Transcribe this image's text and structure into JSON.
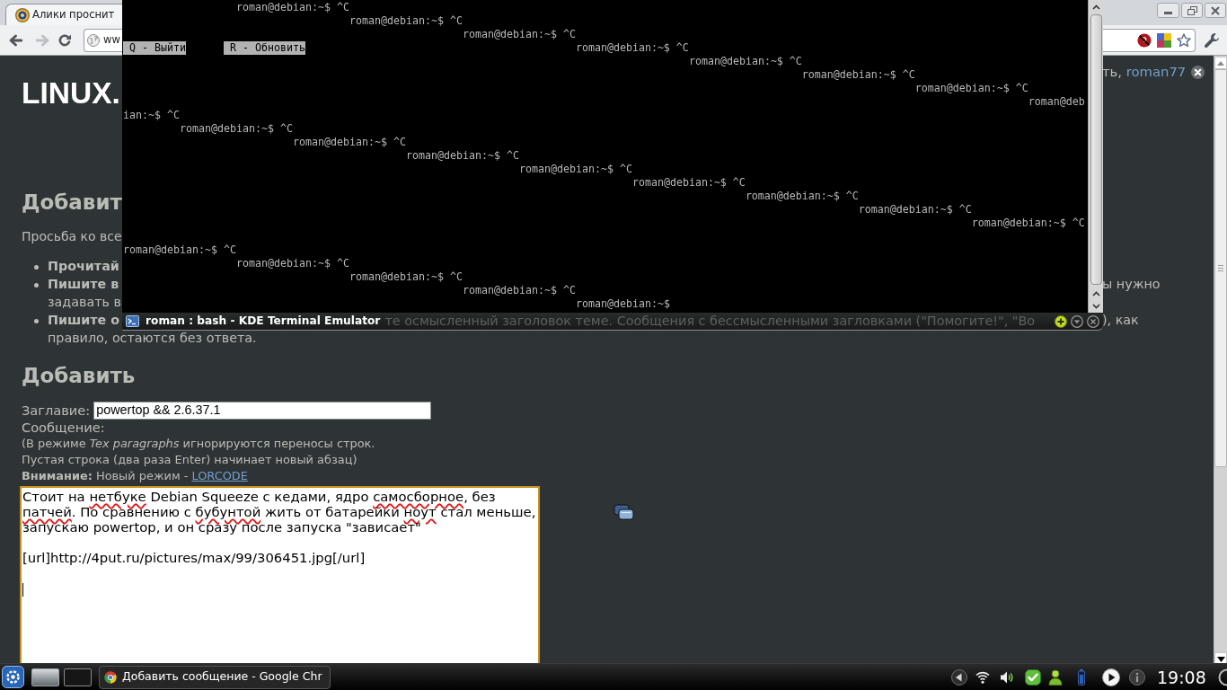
{
  "browser": {
    "tabs": [
      {
        "title": "Алики проснит",
        "selected": true
      }
    ],
    "nav_buttons": [
      {
        "kind": "back",
        "disabled": false
      },
      {
        "kind": "forward",
        "disabled": true
      },
      {
        "kind": "reload",
        "disabled": false
      }
    ],
    "address_bar": {
      "value": "ww"
    },
    "page": {
      "user_bar": {
        "text": "ть,",
        "username": "roman77"
      },
      "site_title": "LINUX.",
      "guidelines": {
        "heading": "Добавит",
        "intro": "Просьба ко все",
        "rules": [
          {
            "title": "Прочитай"
          },
          {
            "title": "Пишите в",
            "right_part": "ы нужно",
            "next_line": "задавать в"
          },
          {
            "title": "Пишите о",
            "behind_terminal_bar": "те осмысленный заголовок теме. Сообщения с бессмысленными загловками (\"Помогите!\", \"Во",
            "right_part": "), как",
            "next_line": "правило, остаются без ответа."
          }
        ]
      },
      "form": {
        "heading": "Добавить",
        "title_field": {
          "label": "Заглавие:",
          "value": "powertop && 2.6.37.1"
        },
        "message_field": {
          "label": "Сообщение:",
          "hint_lines": [
            "(В режиме *Tex paragraphs* игнорируются переносы строк.",
            "Пустая строка (два раза Enter) начинает новый абзац)"
          ],
          "notice": {
            "text": "**Внимание:** Новый режим - ",
            "link": "LORCODE"
          },
          "focused": true,
          "value": [
            {
              "text": "Стоит на ",
              "misspelled": false
            },
            {
              "text": "нетбуке",
              "misspelled": true
            },
            {
              "text": " Debian Squeeze с кедами, ядро ",
              "misspelled": false
            },
            {
              "text": "самосборное",
              "misspelled": true
            },
            {
              "text": ", без ",
              "misspelled": false
            },
            {
              "text": "патчей",
              "misspelled": true
            },
            {
              "text": ". По сравнению с ",
              "misspelled": false
            },
            {
              "text": "бубунтой",
              "misspelled": true
            },
            {
              "text": " жить от батарейки ",
              "misspelled": false
            },
            {
              "text": "ноут",
              "misspelled": true
            },
            {
              "text": " стал меньше, запускаю powertop, и он сразу после запуска \"зависает\"\n\n[url]http://4put.ru/pictures/max/99/306451.jpg[/url]\n\n",
              "misspelled": false
            }
          ]
        }
      }
    }
  },
  "terminal": {
    "rows": [
      {
        "kind": "text",
        "segments": [
          {
            "kind": "output",
            "text": "                  roman@debian:~$ ^C"
          }
        ]
      },
      {
        "kind": "text",
        "segments": [
          {
            "kind": "output",
            "text": "                                    roman@debian:~$ ^C"
          }
        ]
      },
      {
        "kind": "text",
        "segments": [
          {
            "kind": "output",
            "text": "                                                      roman@debian:~$ ^C"
          }
        ]
      },
      {
        "kind": "text",
        "segments": [
          {
            "kind": "key_hint",
            "text": " Q - Выйти"
          },
          {
            "kind": "key_hint",
            "text": "       R - Обновить"
          },
          {
            "kind": "output",
            "text": "                                           roman@debian:~$ ^C"
          }
        ]
      },
      {
        "kind": "text",
        "segments": [
          {
            "kind": "output",
            "text": "                                                                                          roman@debian:~$ ^C"
          }
        ]
      },
      {
        "kind": "text",
        "segments": [
          {
            "kind": "output",
            "text": "                                                                                                            roman@debian:~$ ^C"
          }
        ]
      },
      {
        "kind": "text",
        "segments": [
          {
            "kind": "output",
            "text": "                                                                                                                              roman@debian:~$ ^C"
          }
        ]
      },
      {
        "kind": "text",
        "segments": [
          {
            "kind": "output",
            "text": "                                                                                                                                                roman@deb"
          }
        ]
      },
      {
        "kind": "text",
        "segments": [
          {
            "kind": "output",
            "text": "ian:~$ ^C"
          }
        ]
      },
      {
        "kind": "text",
        "segments": [
          {
            "kind": "output",
            "text": "         roman@debian:~$ ^C"
          }
        ]
      },
      {
        "kind": "text",
        "segments": [
          {
            "kind": "output",
            "text": "                           roman@debian:~$ ^C"
          }
        ]
      },
      {
        "kind": "text",
        "segments": [
          {
            "kind": "output",
            "text": "                                             roman@debian:~$ ^C"
          }
        ]
      },
      {
        "kind": "text",
        "segments": [
          {
            "kind": "output",
            "text": "                                                               roman@debian:~$ ^C"
          }
        ]
      },
      {
        "kind": "text",
        "segments": [
          {
            "kind": "output",
            "text": "                                                                                 roman@debian:~$ ^C"
          }
        ]
      },
      {
        "kind": "text",
        "segments": [
          {
            "kind": "output",
            "text": "                                                                                                   roman@debian:~$ ^C"
          }
        ]
      },
      {
        "kind": "text",
        "segments": [
          {
            "kind": "output",
            "text": "                                                                                                                     roman@debian:~$ ^C"
          }
        ]
      },
      {
        "kind": "text",
        "segments": [
          {
            "kind": "output",
            "text": "                                                                                                                                       roman@debian:~$ ^C"
          }
        ]
      },
      {
        "kind": "blank"
      },
      {
        "kind": "text",
        "segments": [
          {
            "kind": "output",
            "text": "roman@debian:~$ ^C"
          }
        ]
      },
      {
        "kind": "text",
        "segments": [
          {
            "kind": "output",
            "text": "                  roman@debian:~$ ^C"
          }
        ]
      },
      {
        "kind": "text",
        "segments": [
          {
            "kind": "output",
            "text": "                                    roman@debian:~$ ^C"
          }
        ]
      },
      {
        "kind": "text",
        "segments": [
          {
            "kind": "output",
            "text": "                                                      roman@debian:~$ ^C"
          }
        ]
      },
      {
        "kind": "text",
        "segments": [
          {
            "kind": "output",
            "text": "                                                                        roman@debian:~$"
          }
        ]
      }
    ],
    "tab_title": "roman : bash - KDE Terminal Emulator"
  },
  "taskbar": {
    "desktops": [
      {
        "selected": true
      },
      {
        "selected": false
      }
    ],
    "tasks": [
      {
        "title": "Добавить сообщение - Google Chr",
        "selected": true
      }
    ],
    "clock": "19:08"
  }
}
